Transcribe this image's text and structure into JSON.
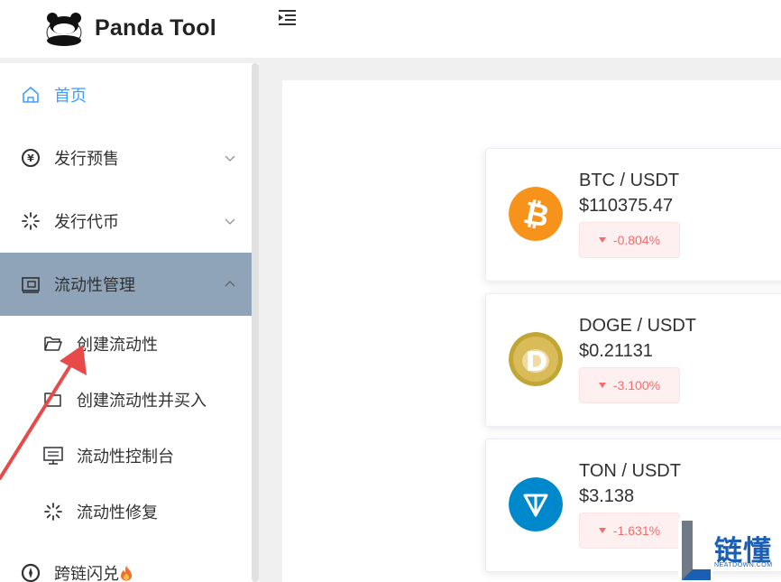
{
  "header": {
    "brand": "Panda Tool"
  },
  "sidebar": {
    "items": [
      {
        "label": "首页",
        "icon": "home-icon",
        "state": "active"
      },
      {
        "label": "发行预售",
        "icon": "yen-coin-icon",
        "state": "collapsed"
      },
      {
        "label": "发行代币",
        "icon": "loading-spinner-icon",
        "state": "collapsed"
      },
      {
        "label": "流动性管理",
        "icon": "wallet-icon",
        "state": "expanded"
      },
      {
        "label": "跨链闪兑",
        "icon": "compass-icon",
        "state": "collapsed"
      }
    ],
    "sub_items": [
      {
        "label": "创建流动性",
        "icon": "folder-open-icon"
      },
      {
        "label": "创建流动性并买入",
        "icon": "folder-icon"
      },
      {
        "label": "流动性控制台",
        "icon": "monitor-icon"
      },
      {
        "label": "流动性修复",
        "icon": "loading-spinner-icon"
      }
    ],
    "active_color": "#409eff",
    "expanded_bg": "#8fa4b8"
  },
  "tickers": [
    {
      "pair": "BTC / USDT",
      "price": "$110375.47",
      "change": "-0.804%",
      "icon": "bitcoin-icon",
      "color": "#f7931a"
    },
    {
      "pair": "DOGE / USDT",
      "price": "$0.21131",
      "change": "-3.100%",
      "icon": "dogecoin-icon",
      "color": "#c2a633"
    },
    {
      "pair": "TON / USDT",
      "price": "$3.138",
      "change": "-1.631%",
      "icon": "toncoin-icon",
      "color": "#0088cc"
    }
  ],
  "watermark": {
    "text": "链懂",
    "sub": "NEATDOWN.COM"
  },
  "colors": {
    "negative": "#f56c6c",
    "negative_bg": "#fef0f0",
    "annotation_arrow": "#e84a4a"
  }
}
